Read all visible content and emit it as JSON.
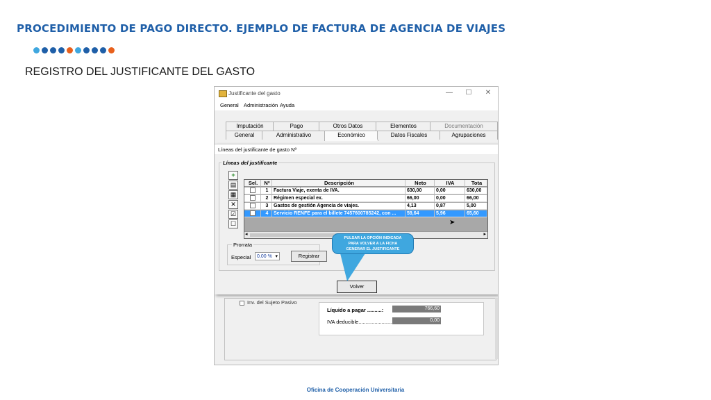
{
  "slide": {
    "title": "PROCEDIMIENTO DE PAGO DIRECTO. EJEMPLO DE FACTURA DE AGENCIA DE VIAJES",
    "subtitle": "REGISTRO DEL JUSTIFICANTE DEL GASTO",
    "footer": "Oficina de Cooperación Universitaria",
    "dot_colors": [
      "#3fa7df",
      "#1f5fa8",
      "#1f5fa8",
      "#1f5fa8",
      "#e8601c",
      "#3fa7df",
      "#1f5fa8",
      "#1f5fa8",
      "#1f5fa8",
      "#e8601c"
    ]
  },
  "window": {
    "title": "Justificante del gasto",
    "controls": {
      "minimize": "—",
      "maximize": "☐",
      "close": "✕"
    },
    "menu": [
      "General",
      "Administración",
      "Ayuda"
    ],
    "tabs_back": [
      "Imputación",
      "Pago",
      "Otros Datos",
      "Elementos",
      "Documentación"
    ],
    "tabs_front": [
      "General",
      "Administrativo",
      "Económico",
      "Datos Fiscales",
      "Agrupaciones"
    ]
  },
  "dialog": {
    "title": "Líneas del justificante de gasto Nº",
    "group_label": "Líneas del justificante",
    "columns": [
      "Sel.",
      "Nº",
      "Descripción",
      "Neto",
      "IVA",
      "Tota"
    ],
    "rows": [
      {
        "n": "1",
        "desc": "Factura Viaje, exenta de IVA.",
        "neto": "630,00",
        "iva": "0,00",
        "total": "630,00",
        "selected": false
      },
      {
        "n": "2",
        "desc": "Régimen especial ex.",
        "neto": "66,00",
        "iva": "0,00",
        "total": "66,00",
        "selected": false
      },
      {
        "n": "3",
        "desc": "Gastos de gestión Agencia de viajes.",
        "neto": "4,13",
        "iva": "0,87",
        "total": "5,00",
        "selected": false
      },
      {
        "n": "4",
        "desc": "Servicio RENFE para el billete 7457600785242, con ...",
        "neto": "59,64",
        "iva": "5,96",
        "total": "65,60",
        "selected": true
      }
    ],
    "tools": [
      "add-icon",
      "edit-icon",
      "open-folder-icon",
      "delete-icon",
      "check-all-icon",
      "uncheck-all-icon"
    ],
    "tool_glyphs": [
      "+",
      "▤",
      "▦",
      "✕",
      "☑",
      "☐"
    ],
    "prorrata_label": "Prorrata",
    "especial_label": "Especial",
    "especial_value": "0,00 %",
    "registrar_label": "Registrar",
    "volver_label": "Volver"
  },
  "callout": {
    "line1": "PULSAR LA OPCIÓN INDICADA",
    "line2": "PARA VOLVER A LA FICHA",
    "line3": "GENERAR EL JUSTIFICANTE"
  },
  "lower": {
    "inv_label": "Inv. del Sujeto Pasivo",
    "liquido_label": "Líquido a pagar ..........:",
    "liquido_value": "766,60",
    "iva_label": "IVA deducible.........................",
    "iva_value": "0,00"
  }
}
